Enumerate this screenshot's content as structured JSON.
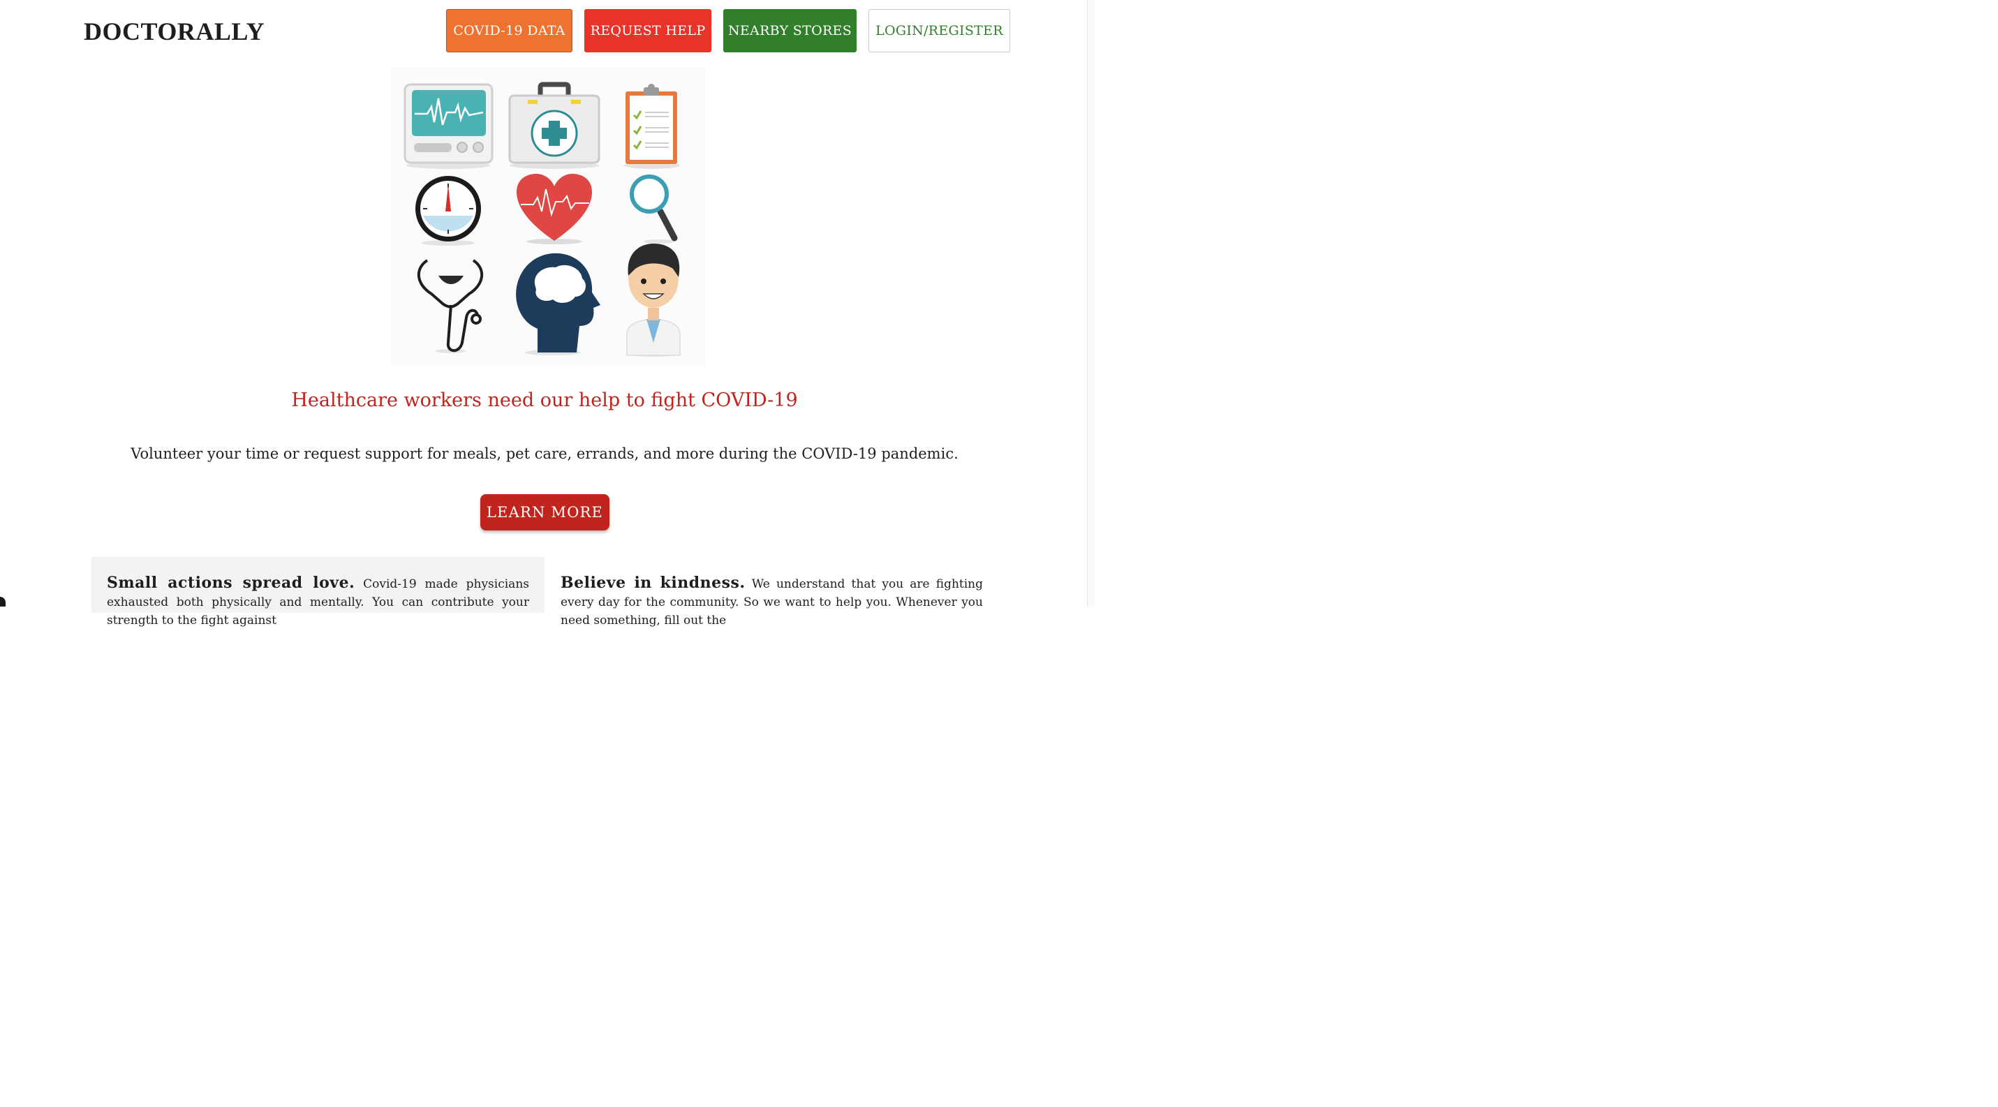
{
  "brand": "DOCTORALLY",
  "nav": {
    "covid_data": "COVID-19 DATA",
    "request_help": "REQUEST HELP",
    "nearby_stores": "NEARBY STORES",
    "login_register": "LOGIN/REGISTER"
  },
  "hero": {
    "icons": [
      "heart-monitor-icon",
      "first-aid-kit-icon",
      "clipboard-checklist-icon",
      "stopwatch-icon",
      "heartbeat-heart-icon",
      "magnifier-icon",
      "stethoscope-icon",
      "brain-head-icon",
      "doctor-avatar-icon"
    ]
  },
  "headline": "Healthcare workers need our help to fight COVID-19",
  "subline": "Volunteer your time or request support for meals, pet care, errands, and more during the COVID-19 pandemic.",
  "cta": {
    "learn_more": "LEARN MORE"
  },
  "cards": {
    "left": {
      "lead": "Small actions spread love.",
      "body": "Covid-19 made physicians exhausted both physically and mentally. You can contribute your strength to the fight against"
    },
    "right": {
      "lead": "Believe in kindness.",
      "body": "We understand that you are fighting every day for the community. So we want to help you. Whenever you need something, fill out the"
    }
  },
  "colors": {
    "accent_red": "#c0241c",
    "covid_orange": "#ef7330",
    "help_red": "#e8322a",
    "stores_green": "#317f2a"
  }
}
